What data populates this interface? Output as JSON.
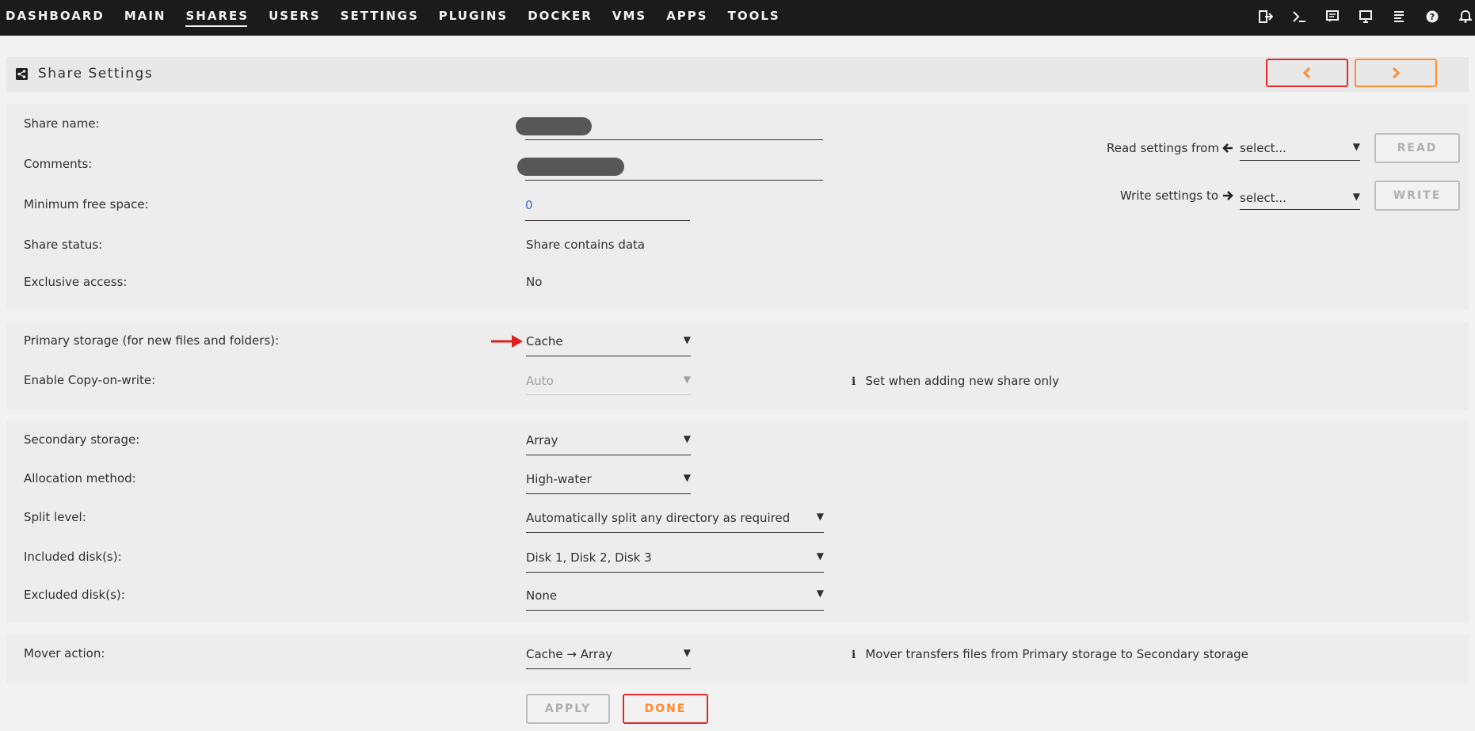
{
  "nav": {
    "items": [
      "DASHBOARD",
      "MAIN",
      "SHARES",
      "USERS",
      "SETTINGS",
      "PLUGINS",
      "DOCKER",
      "VMS",
      "APPS",
      "TOOLS"
    ],
    "active": "SHARES",
    "icons": [
      "logout-icon",
      "terminal-icon",
      "feedback-icon",
      "display-icon",
      "log-icon",
      "help-icon",
      "bell-icon"
    ]
  },
  "header": {
    "title": "Share Settings",
    "icon": "share-icon",
    "prev_icon": "chevron-left-icon",
    "next_icon": "chevron-right-icon"
  },
  "general": {
    "share_name_label": "Share name:",
    "comments_label": "Comments:",
    "min_free_label": "Minimum free space:",
    "min_free_value": "0",
    "status_label": "Share status:",
    "status_value": "Share contains data",
    "exclusive_label": "Exclusive access:",
    "exclusive_value": "No",
    "read_from_label": "Read settings from",
    "read_select": "select...",
    "read_button": "READ",
    "write_to_label": "Write settings to",
    "write_select": "select...",
    "write_button": "WRITE"
  },
  "primary": {
    "primary_label": "Primary storage (for new files and folders):",
    "primary_value": "Cache",
    "cow_label": "Enable Copy-on-write:",
    "cow_value": "Auto",
    "cow_info": "Set when adding new share only"
  },
  "secondary": {
    "secondary_label": "Secondary storage:",
    "secondary_value": "Array",
    "alloc_label": "Allocation method:",
    "alloc_value": "High-water",
    "split_label": "Split level:",
    "split_value": "Automatically split any directory as required",
    "included_label": "Included disk(s):",
    "included_value": "Disk 1, Disk 2, Disk 3",
    "excluded_label": "Excluded disk(s):",
    "excluded_value": "None"
  },
  "mover": {
    "mover_label": "Mover action:",
    "mover_value": "Cache → Array",
    "mover_info": "Mover transfers files from Primary storage to Secondary storage"
  },
  "actions": {
    "apply": "APPLY",
    "done": "DONE"
  },
  "colors": {
    "accent_orange": "#ff8c2f",
    "accent_red": "#e22828",
    "nav_bg": "#1c1b1b"
  }
}
